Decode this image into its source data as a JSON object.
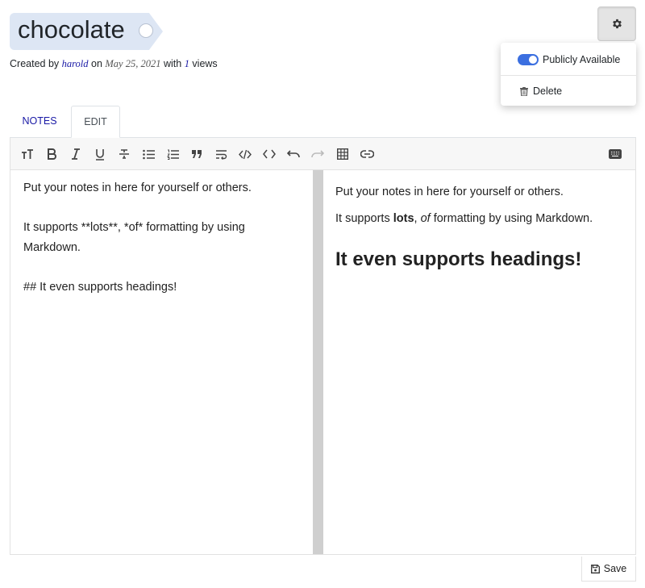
{
  "note": {
    "title": "chocolate",
    "meta_prefix": "Created by",
    "author": "harold",
    "meta_on": "on",
    "date": "May 25, 2021",
    "meta_with": "with",
    "views_count": "1",
    "views_label": "views"
  },
  "settings_menu": {
    "publicly_available_label": "Publicly Available",
    "publicly_available_enabled": true,
    "delete_label": "Delete"
  },
  "tabs": [
    {
      "label": "NOTES",
      "active": false
    },
    {
      "label": "EDIT",
      "active": true
    }
  ],
  "toolbar": {
    "icons": [
      "heading-icon",
      "bold-icon",
      "italic-icon",
      "underline-icon",
      "strikethrough-icon",
      "bullet-list-icon",
      "numbered-list-icon",
      "quote-icon",
      "wrap-text-icon",
      "code-block-icon",
      "inline-code-icon",
      "undo-icon",
      "redo-icon",
      "table-icon",
      "link-icon",
      "keyboard-icon"
    ]
  },
  "editor": {
    "source_lines": [
      "Put your notes in here for yourself or others.",
      "It supports **lots**, *of* formatting by using Markdown.",
      "## It even supports headings!"
    ]
  },
  "preview": {
    "para1": "Put your notes in here for yourself or others.",
    "para2_prefix": "It supports ",
    "para2_bold": "lots",
    "para2_comma": ", ",
    "para2_italic": "of",
    "para2_suffix": " formatting by using Markdown.",
    "heading": "It even supports headings!"
  },
  "save_label": "Save",
  "colors": {
    "tag_bg": "#dde6f4",
    "link": "#1a1aa6",
    "toggle_on": "#3b6fe0"
  }
}
